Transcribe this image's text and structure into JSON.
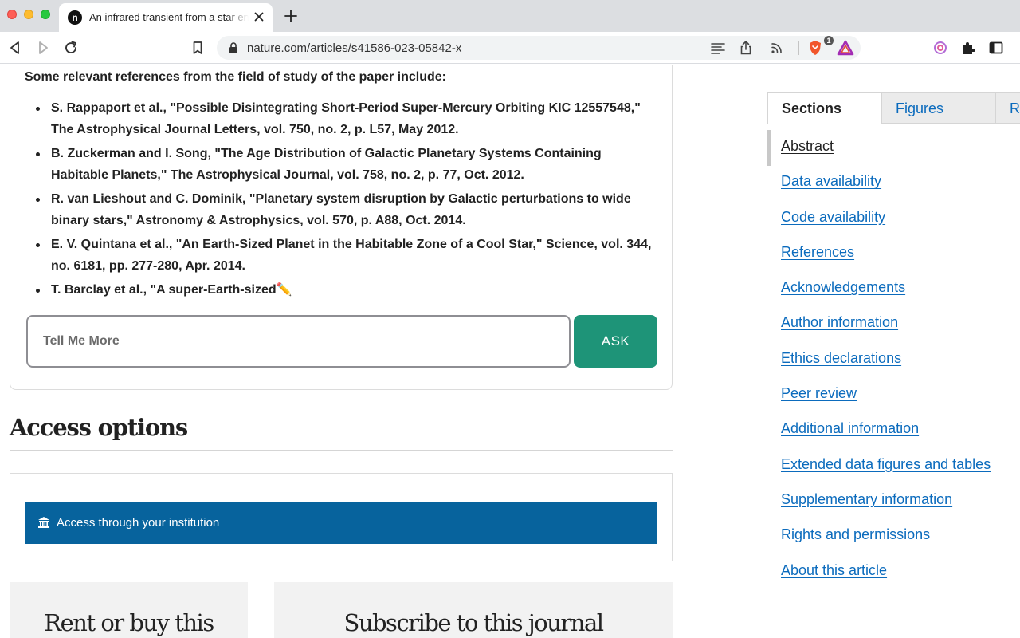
{
  "browser": {
    "tab_title": "An infrared transient from a star engulfing a planet",
    "tab_favicon_letter": "n",
    "url": "nature.com/articles/s41586-023-05842-x",
    "brave_badge_count": "1"
  },
  "chat": {
    "intro": "Some relevant references from the field of study of the paper include:",
    "references": [
      "S. Rappaport et al., \"Possible Disintegrating Short-Period Super-Mercury Orbiting KIC 12557548,\" The Astrophysical Journal Letters, vol. 750, no. 2, p. L57, May 2012.",
      "B. Zuckerman and I. Song, \"The Age Distribution of Galactic Planetary Systems Containing Habitable Planets,\" The Astrophysical Journal, vol. 758, no. 2, p. 77, Oct. 2012.",
      "R. van Lieshout and C. Dominik, \"Planetary system disruption by Galactic perturbations to wide binary stars,\" Astronomy & Astrophysics, vol. 570, p. A88, Oct. 2014.",
      "E. V. Quintana et al., \"An Earth-Sized Planet in the Habitable Zone of a Cool Star,\" Science, vol. 344, no. 6181, pp. 277-280, Apr. 2014.",
      "T. Barclay et al., \"A super-Earth-sized"
    ],
    "typing_indicator": "✏️",
    "input_placeholder": "Tell Me More",
    "ask_label": "ASK"
  },
  "access": {
    "heading": "Access options",
    "institution_label": "Access through your institution",
    "rent_title": "Rent or buy this",
    "subscribe_title": "Subscribe to this journal"
  },
  "sidebar": {
    "tabs": [
      "Sections",
      "Figures",
      "References"
    ],
    "active_tab": "Sections",
    "items": [
      "Abstract",
      "Data availability",
      "Code availability",
      "References",
      "Acknowledgements",
      "Author information",
      "Ethics declarations",
      "Peer review",
      "Additional information",
      "Extended data figures and tables",
      "Supplementary information",
      "Rights and permissions",
      "About this article"
    ],
    "current_item": "Abstract"
  },
  "colors": {
    "ask_button": "#1e9478",
    "institution_button": "#07639d",
    "link": "#0b6bbd"
  }
}
